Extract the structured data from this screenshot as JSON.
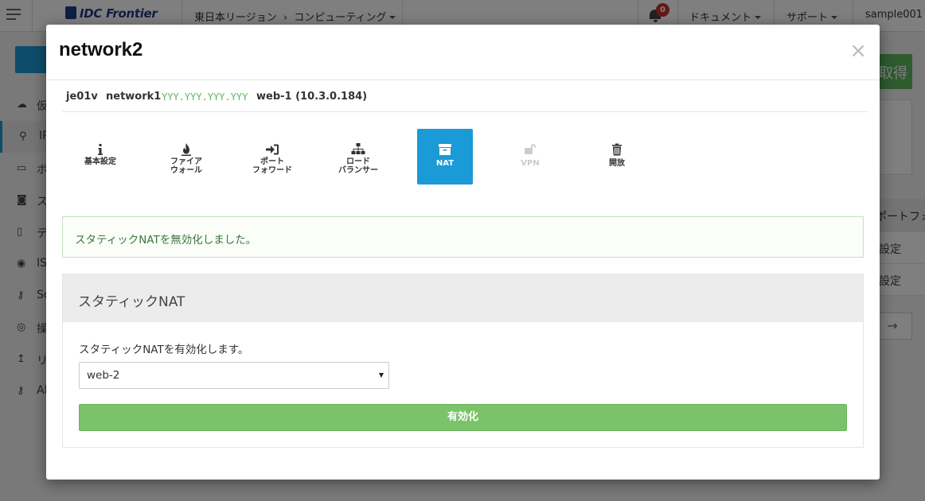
{
  "topbar": {
    "logo_text": "IDC Frontier",
    "region": "東日本リージョン",
    "region_sep": "›",
    "service": "コンピューティング",
    "notification_count": "0",
    "nav": [
      "ドキュメント",
      "サポート",
      "sample001"
    ]
  },
  "background": {
    "sidebar_labels": [
      "仮",
      "IP",
      "ボ",
      "ス",
      "デ",
      "IS",
      "Sc",
      "操",
      "リ",
      "AF"
    ],
    "green_button_label": "取得",
    "right_heading": "ポートフォ",
    "right_rows": [
      "設定",
      "設定"
    ],
    "arrow_label": "→"
  },
  "modal": {
    "title": "network2",
    "close_label": "×",
    "crumbs": {
      "zone": "je01v",
      "network": "network1",
      "ip": "YYY.YYY.YYY.YYY",
      "vm": "web-1 (10.3.0.184)"
    },
    "tabs": [
      {
        "label": "基本設定",
        "icon": "info-icon",
        "state": "normal"
      },
      {
        "label": "ファイア\nウォール",
        "icon": "fire-icon",
        "state": "normal"
      },
      {
        "label": "ポート\nフォワード",
        "icon": "sign-in-icon",
        "state": "normal"
      },
      {
        "label": "ロード\nバランサー",
        "icon": "sitemap-icon",
        "state": "normal"
      },
      {
        "label": "NAT",
        "icon": "archive-icon",
        "state": "active"
      },
      {
        "label": "VPN",
        "icon": "unlock-icon",
        "state": "disabled"
      },
      {
        "label": "開放",
        "icon": "trash-icon",
        "state": "normal"
      }
    ],
    "alert_text": "スタティックNATを無効化しました。",
    "panel": {
      "heading": "スタティックNAT",
      "label": "スタティックNATを有効化します。",
      "select_value": "web-2",
      "button_label": "有効化"
    }
  },
  "colors": {
    "accent": "#1a9ad6",
    "success": "#7bc36a",
    "ip_green": "#5cb85c",
    "alert_text": "#3c763d"
  }
}
